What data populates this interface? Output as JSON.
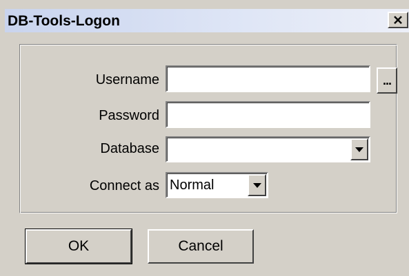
{
  "window": {
    "title": "DB-Tools-Logon"
  },
  "form": {
    "username": {
      "label": "Username",
      "value": ""
    },
    "password": {
      "label": "Password",
      "value": ""
    },
    "database": {
      "label": "Database",
      "value": ""
    },
    "connect_as": {
      "label": "Connect as",
      "value": "Normal"
    },
    "browse_button_label": "..."
  },
  "buttons": {
    "ok_label": "OK",
    "cancel_label": "Cancel"
  },
  "icons": {
    "close": "close-icon",
    "dropdown": "chevron-down-icon"
  },
  "colors": {
    "dialog_bg": "#d4d0c8",
    "titlebar_start": "#c9d4ee",
    "titlebar_end": "#eceff8"
  }
}
